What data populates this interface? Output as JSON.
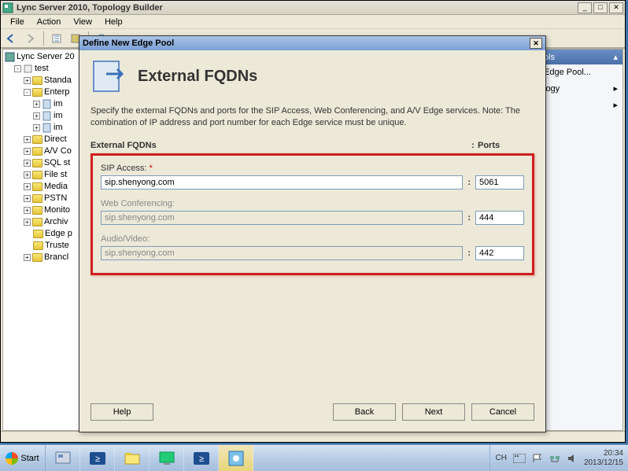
{
  "window": {
    "title": "Lync Server 2010, Topology Builder",
    "menu": [
      "File",
      "Action",
      "View",
      "Help"
    ]
  },
  "tree": {
    "root": "Lync Server 20",
    "test": "test",
    "items": [
      "Standa",
      "Enterp",
      "im",
      "im",
      "im",
      "Direct",
      "A/V Co",
      "SQL st",
      "File st",
      "Media",
      "PSTN",
      "Monito",
      "Archiv",
      "Edge p",
      "Truste",
      "Brancl"
    ]
  },
  "right": {
    "header": "ols",
    "i1": "Edge Pool...",
    "i2": "logy"
  },
  "dialog": {
    "title": "Define New Edge Pool",
    "heading": "External FQDNs",
    "desc": "Specify the external FQDNs and ports for the SIP Access, Web Conferencing, and A/V Edge services. Note: The combination of IP address and port number for each Edge service must be unique.",
    "col1": "External FQDNs",
    "col2": "Ports",
    "sip_label": "SIP Access:",
    "sip_fqdn": "sip.shenyong.com",
    "sip_port": "5061",
    "web_label": "Web Conferencing:",
    "web_fqdn": "sip.shenyong.com",
    "web_port": "444",
    "av_label": "Audio/Video:",
    "av_fqdn": "sip.shenyong.com",
    "av_port": "442",
    "help": "Help",
    "back": "Back",
    "next": "Next",
    "cancel": "Cancel"
  },
  "taskbar": {
    "start": "Start",
    "lang": "CH",
    "time": "20:34",
    "date": "2013/12/15"
  }
}
